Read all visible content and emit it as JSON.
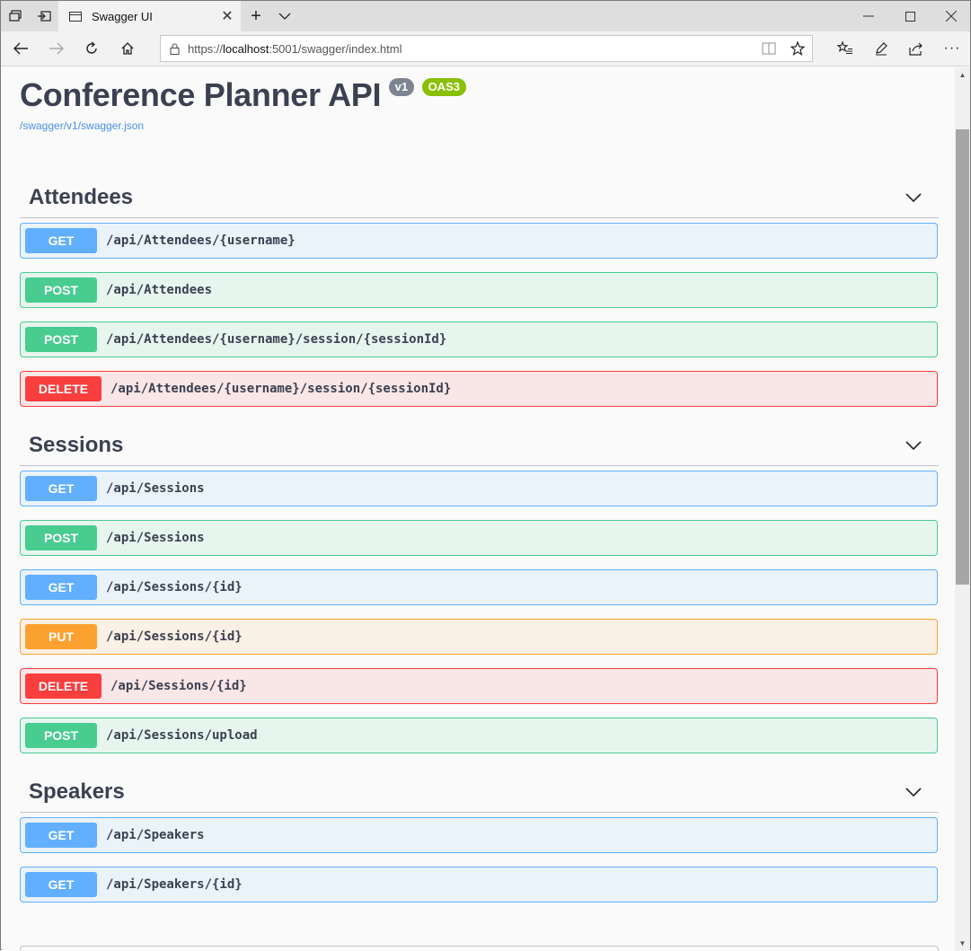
{
  "browser": {
    "tab_title": "Swagger UI",
    "url_prefix": "https://",
    "url_host": "localhost",
    "url_rest": ":5001/swagger/index.html"
  },
  "info": {
    "title": "Conference Planner API",
    "version_badge": "v1",
    "oas_badge": "OAS3",
    "spec_link": "/swagger/v1/swagger.json"
  },
  "tags": [
    {
      "name": "Attendees",
      "operations": [
        {
          "method": "GET",
          "path": "/api/Attendees/{username}"
        },
        {
          "method": "POST",
          "path": "/api/Attendees"
        },
        {
          "method": "POST",
          "path": "/api/Attendees/{username}/session/{sessionId}"
        },
        {
          "method": "DELETE",
          "path": "/api/Attendees/{username}/session/{sessionId}"
        }
      ]
    },
    {
      "name": "Sessions",
      "operations": [
        {
          "method": "GET",
          "path": "/api/Sessions"
        },
        {
          "method": "POST",
          "path": "/api/Sessions"
        },
        {
          "method": "GET",
          "path": "/api/Sessions/{id}"
        },
        {
          "method": "PUT",
          "path": "/api/Sessions/{id}"
        },
        {
          "method": "DELETE",
          "path": "/api/Sessions/{id}"
        },
        {
          "method": "POST",
          "path": "/api/Sessions/upload"
        }
      ]
    },
    {
      "name": "Speakers",
      "operations": [
        {
          "method": "GET",
          "path": "/api/Speakers"
        },
        {
          "method": "GET",
          "path": "/api/Speakers/{id}"
        }
      ]
    }
  ],
  "colors": {
    "get": "#61affe",
    "post": "#49cc90",
    "put": "#fca130",
    "delete": "#f93e3e",
    "text": "#3b4151",
    "link": "#4990e2"
  }
}
